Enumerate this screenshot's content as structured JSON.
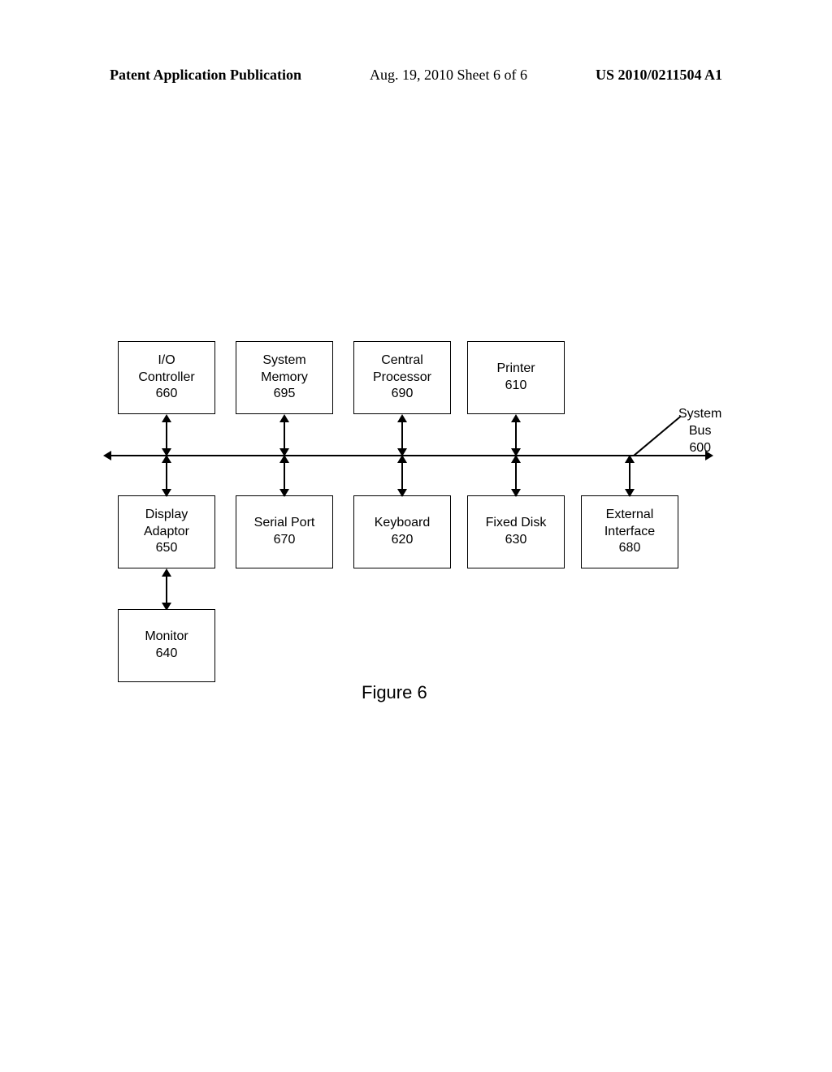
{
  "header": {
    "left": "Patent Application Publication",
    "center": "Aug. 19, 2010  Sheet 6 of 6",
    "right": "US 2010/0211504 A1"
  },
  "diagram": {
    "bus_label_line1": "System",
    "bus_label_line2": "Bus",
    "bus_label_line3": "600",
    "top_boxes": {
      "io": {
        "l1": "I/O",
        "l2": "Controller",
        "l3": "660"
      },
      "mem": {
        "l1": "System",
        "l2": "Memory",
        "l3": "695"
      },
      "cpu": {
        "l1": "Central",
        "l2": "Processor",
        "l3": "690"
      },
      "printer": {
        "l1": "Printer",
        "l2": "610",
        "l3": ""
      }
    },
    "bottom_boxes": {
      "disp": {
        "l1": "Display",
        "l2": "Adaptor",
        "l3": "650"
      },
      "ser": {
        "l1": "Serial Port",
        "l2": "670",
        "l3": ""
      },
      "kbd": {
        "l1": "Keyboard",
        "l2": "620",
        "l3": ""
      },
      "fdisk": {
        "l1": "Fixed Disk",
        "l2": "630",
        "l3": ""
      },
      "ext": {
        "l1": "External",
        "l2": "Interface",
        "l3": "680"
      }
    },
    "monitor": {
      "l1": "Monitor",
      "l2": "640"
    },
    "caption": "Figure 6"
  }
}
